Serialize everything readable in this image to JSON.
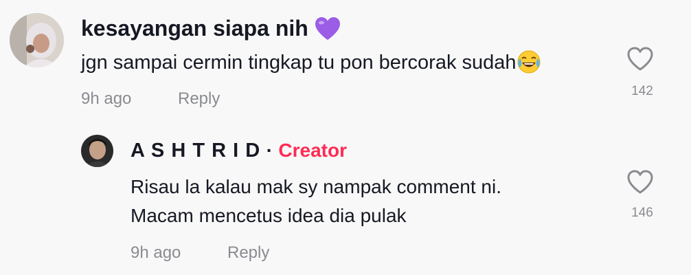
{
  "comment": {
    "username": "kesayangan siapa nih",
    "username_emoji": "purple-heart-icon",
    "text": "jgn sampai cermin tingkap tu pon bercorak sudah",
    "text_emoji": "tears-of-joy-icon",
    "time": "9h ago",
    "reply_label": "Reply",
    "likes": "142"
  },
  "reply": {
    "username": "A S H T R I D",
    "separator": "·",
    "badge": "Creator",
    "line1": "Risau la kalau mak sy nampak comment ni.",
    "line2": "Macam mencetus idea dia pulak",
    "time": "9h ago",
    "reply_label": "Reply",
    "likes": "146"
  },
  "colors": {
    "creator": "#fe2c55",
    "heart_purple": "#9b5de5",
    "meta": "#8a8b91",
    "text": "#161823"
  }
}
